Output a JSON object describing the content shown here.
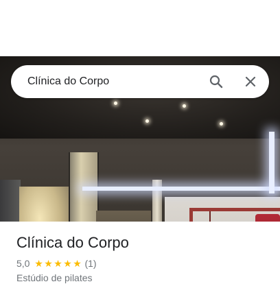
{
  "search": {
    "query": "Clínica do Corpo"
  },
  "place": {
    "name": "Clínica do Corpo",
    "rating": "5,0",
    "stars": 5,
    "review_count": "(1)",
    "category": "Estúdio de pilates"
  },
  "icons": {
    "search": "search-icon",
    "close": "close-icon",
    "star": "star-icon"
  },
  "colors": {
    "star": "#fbbc04",
    "title_text": "#202124",
    "secondary_text": "#70757a",
    "icon": "#5f6368"
  }
}
